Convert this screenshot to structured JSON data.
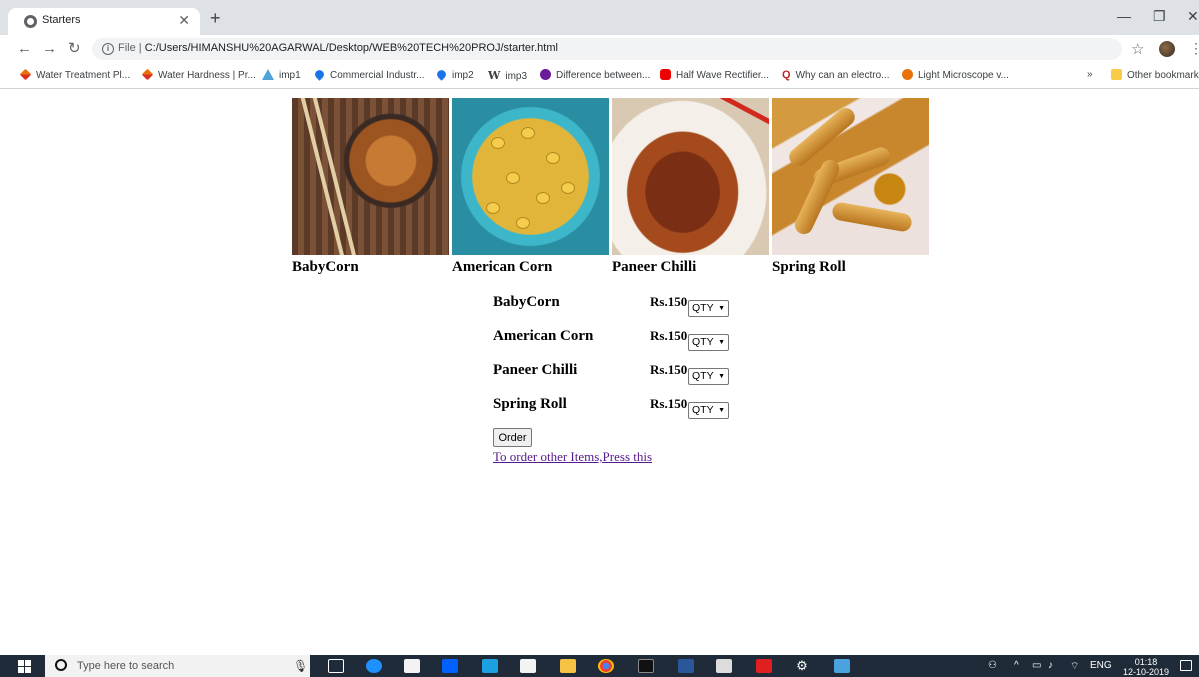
{
  "browser": {
    "tab_title": "Starters",
    "url_scheme": "File",
    "url_path": "C:/Users/HIMANSHU%20AGARWAL/Desktop/WEB%20TECH%20PROJ/starter.html",
    "bookmarks": [
      {
        "label": "Water Treatment Pl...",
        "icon": "diamond-icon"
      },
      {
        "label": "Water Hardness | Pr...",
        "icon": "diamond-icon"
      },
      {
        "label": "imp1",
        "icon": "triangle-icon"
      },
      {
        "label": "Commercial Industr...",
        "icon": "drop-icon"
      },
      {
        "label": "imp2",
        "icon": "drop-icon"
      },
      {
        "label": "imp3",
        "icon": "w-icon"
      },
      {
        "label": "Difference between...",
        "icon": "circle-icon"
      },
      {
        "label": "Half Wave Rectifier...",
        "icon": "youtube-icon"
      },
      {
        "label": "Why can an electro...",
        "icon": "quora-icon"
      },
      {
        "label": "Light Microscope v...",
        "icon": "d-icon"
      }
    ],
    "overflow": "»",
    "other_bookmarks": "Other bookmarks"
  },
  "gallery": [
    {
      "caption": "BabyCorn"
    },
    {
      "caption": "American Corn"
    },
    {
      "caption": "Paneer Chilli"
    },
    {
      "caption": "Spring Roll"
    }
  ],
  "order": {
    "items": [
      {
        "name": "BabyCorn",
        "price": "Rs.150",
        "qty": "QTY"
      },
      {
        "name": "American Corn",
        "price": "Rs.150",
        "qty": "QTY"
      },
      {
        "name": "Paneer Chilli",
        "price": "Rs.150",
        "qty": "QTY"
      },
      {
        "name": "Spring Roll",
        "price": "Rs.150",
        "qty": "QTY"
      }
    ],
    "button_label": "Order",
    "link_text": "To order other Items,Press this"
  },
  "taskbar": {
    "search_placeholder": "Type here to search",
    "language": "ENG",
    "time": "01:18",
    "date": "12-10-2019"
  }
}
